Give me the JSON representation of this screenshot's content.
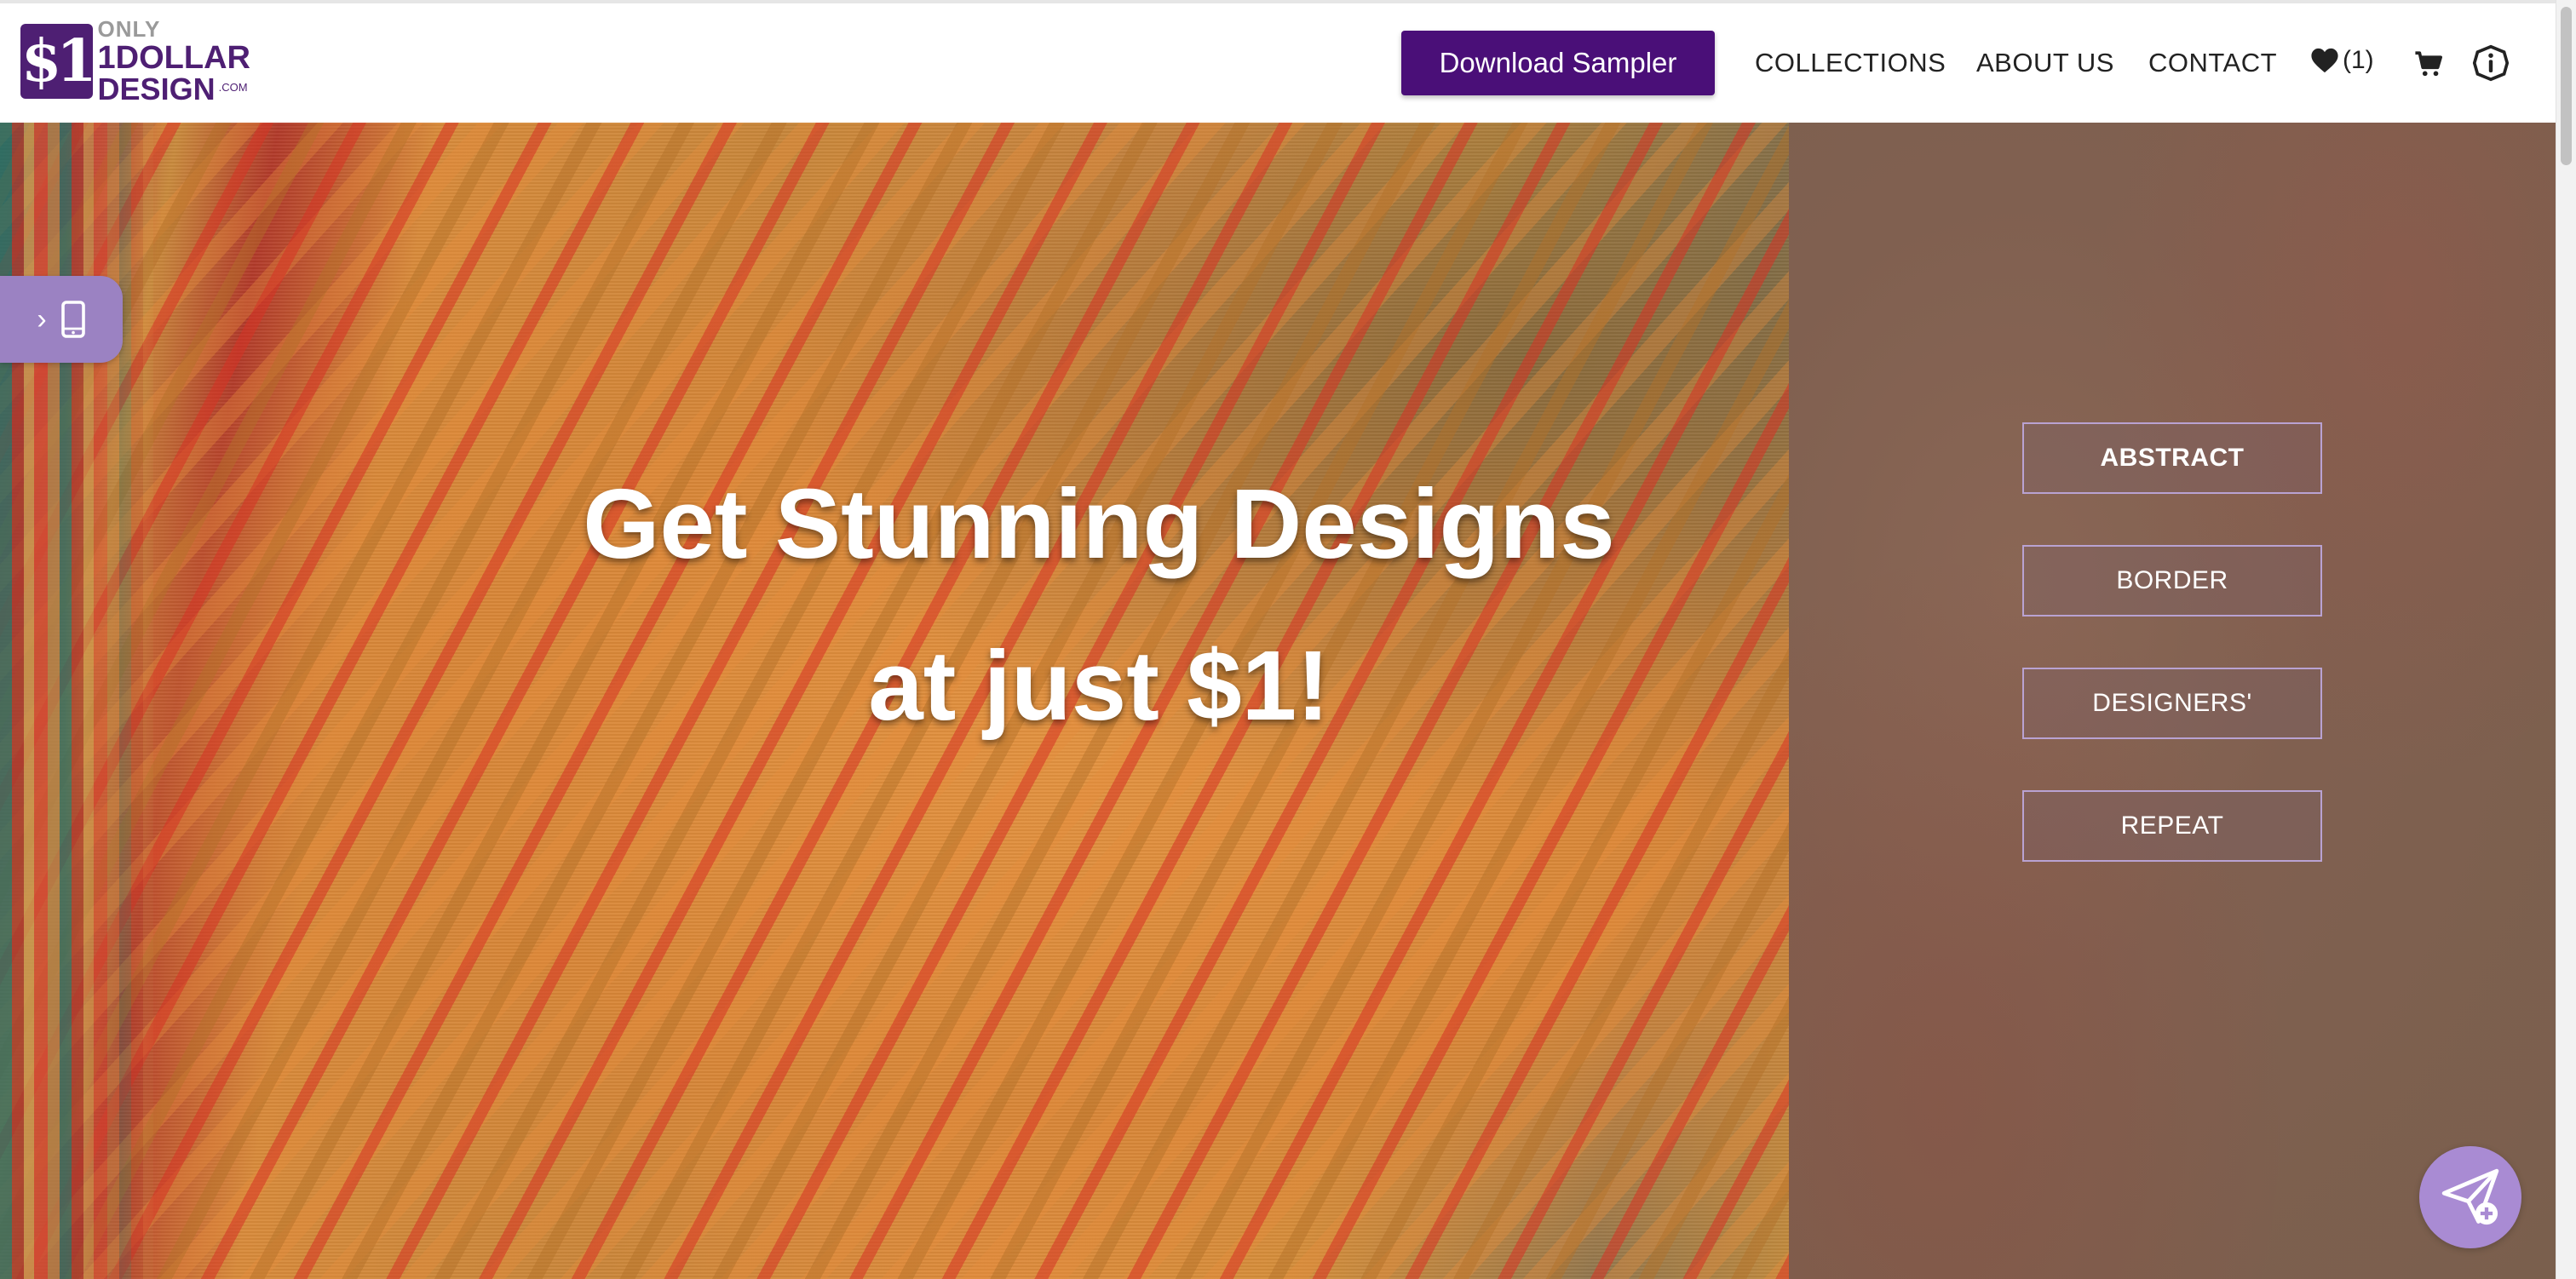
{
  "logo": {
    "mark": "$1",
    "line1": "ONLY",
    "line2": "1DOLLAR",
    "line3": "DESIGN",
    "suffix": ".COM"
  },
  "header": {
    "sampler_label": "Download Sampler",
    "nav": {
      "collections": "COLLECTIONS",
      "about": "ABOUT US",
      "contact": "CONTACT"
    },
    "wishlist_count": "(1)",
    "icons": [
      "heart-icon",
      "cart-icon",
      "info-icon"
    ]
  },
  "hero": {
    "title_line1": "Get Stunning Designs",
    "title_line2": "at just $1!"
  },
  "categories": {
    "abstract": "ABSTRACT",
    "border": "BORDER",
    "designers": "DESIGNERS'",
    "repeat": "REPEAT"
  },
  "mobile_tab": {
    "chevron": "›",
    "icon": "mobile-phone-icon"
  },
  "fab": {
    "icon": "send-plus-icon"
  },
  "colors": {
    "brand_purple": "#4a0f78",
    "accent_lilac": "#a98bd3",
    "button_border": "#b9a2d2"
  }
}
